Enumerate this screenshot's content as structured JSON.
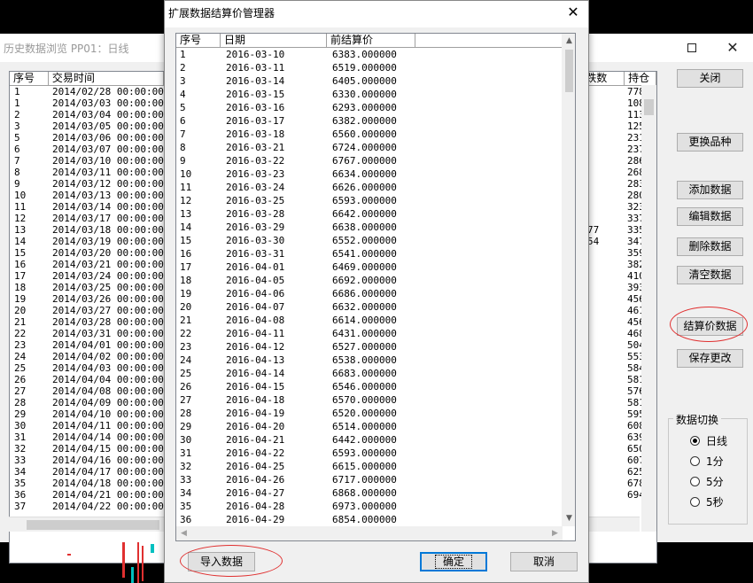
{
  "background_window": {
    "title": "历史数据浏览 PP01：日线",
    "columns": [
      "序号",
      "交易时间"
    ],
    "right_columns": [
      "跌数",
      "持仓"
    ],
    "rows": [
      [
        "1",
        "2014/02/28 00:00:00"
      ],
      [
        "1",
        "2014/03/03 00:00:00"
      ],
      [
        "2",
        "2014/03/04 00:00:00"
      ],
      [
        "3",
        "2014/03/05 00:00:00"
      ],
      [
        "5",
        "2014/03/06 00:00:00"
      ],
      [
        "6",
        "2014/03/07 00:00:00"
      ],
      [
        "7",
        "2014/03/10 00:00:00"
      ],
      [
        "8",
        "2014/03/11 00:00:00"
      ],
      [
        "9",
        "2014/03/12 00:00:00"
      ],
      [
        "10",
        "2014/03/13 00:00:00"
      ],
      [
        "11",
        "2014/03/14 00:00:00"
      ],
      [
        "12",
        "2014/03/17 00:00:00"
      ],
      [
        "13",
        "2014/03/18 00:00:00"
      ],
      [
        "14",
        "2014/03/19 00:00:00"
      ],
      [
        "15",
        "2014/03/20 00:00:00"
      ],
      [
        "16",
        "2014/03/21 00:00:00"
      ],
      [
        "17",
        "2014/03/24 00:00:00"
      ],
      [
        "18",
        "2014/03/25 00:00:00"
      ],
      [
        "19",
        "2014/03/26 00:00:00"
      ],
      [
        "20",
        "2014/03/27 00:00:00"
      ],
      [
        "21",
        "2014/03/28 00:00:00"
      ],
      [
        "22",
        "2014/03/31 00:00:00"
      ],
      [
        "23",
        "2014/04/01 00:00:00"
      ],
      [
        "24",
        "2014/04/02 00:00:00"
      ],
      [
        "25",
        "2014/04/03 00:00:00"
      ],
      [
        "26",
        "2014/04/04 00:00:00"
      ],
      [
        "27",
        "2014/04/08 00:00:00"
      ],
      [
        "28",
        "2014/04/09 00:00:00"
      ],
      [
        "29",
        "2014/04/10 00:00:00"
      ],
      [
        "30",
        "2014/04/11 00:00:00"
      ],
      [
        "31",
        "2014/04/14 00:00:00"
      ],
      [
        "32",
        "2014/04/15 00:00:00"
      ],
      [
        "33",
        "2014/04/16 00:00:00"
      ],
      [
        "34",
        "2014/04/17 00:00:00"
      ],
      [
        "35",
        "2014/04/18 00:00:00"
      ],
      [
        "36",
        "2014/04/21 00:00:00"
      ],
      [
        "37",
        "2014/04/22 00:00:00"
      ]
    ],
    "partial_col_a": [
      "",
      "",
      "",
      "",
      "",
      "",
      "",
      "",
      "",
      "",
      "",
      "",
      "77",
      "54"
    ],
    "partial_col_b": [
      "778",
      "108",
      "113",
      "125",
      "231",
      "237",
      "286",
      "268",
      "283",
      "280",
      "323",
      "337",
      "335",
      "347",
      "359",
      "382",
      "410",
      "393",
      "456",
      "461",
      "456",
      "468",
      "504",
      "553",
      "584",
      "581",
      "576",
      "581",
      "595",
      "608",
      "639",
      "650",
      "607",
      "625",
      "678",
      "694"
    ],
    "side_buttons": {
      "close": "关闭",
      "change_variety": "更换品种",
      "add_data": "添加数据",
      "edit_data": "编辑数据",
      "delete_data": "删除数据",
      "clear_data": "清空数据",
      "settlement_data": "结算价数据",
      "save_changes": "保存更改"
    },
    "data_switch": {
      "title": "数据切换",
      "options": [
        "日线",
        "1分",
        "5分",
        "5秒"
      ],
      "selected": "日线"
    }
  },
  "dialog": {
    "title": "扩展数据结算价管理器",
    "columns": [
      "序号",
      "日期",
      "前结算价"
    ],
    "rows": [
      [
        "1",
        "2016-03-10",
        "6383.000000"
      ],
      [
        "2",
        "2016-03-11",
        "6519.000000"
      ],
      [
        "3",
        "2016-03-14",
        "6405.000000"
      ],
      [
        "4",
        "2016-03-15",
        "6330.000000"
      ],
      [
        "5",
        "2016-03-16",
        "6293.000000"
      ],
      [
        "6",
        "2016-03-17",
        "6382.000000"
      ],
      [
        "7",
        "2016-03-18",
        "6560.000000"
      ],
      [
        "8",
        "2016-03-21",
        "6724.000000"
      ],
      [
        "9",
        "2016-03-22",
        "6767.000000"
      ],
      [
        "10",
        "2016-03-23",
        "6634.000000"
      ],
      [
        "11",
        "2016-03-24",
        "6626.000000"
      ],
      [
        "12",
        "2016-03-25",
        "6593.000000"
      ],
      [
        "13",
        "2016-03-28",
        "6642.000000"
      ],
      [
        "14",
        "2016-03-29",
        "6638.000000"
      ],
      [
        "15",
        "2016-03-30",
        "6552.000000"
      ],
      [
        "16",
        "2016-03-31",
        "6541.000000"
      ],
      [
        "17",
        "2016-04-01",
        "6469.000000"
      ],
      [
        "18",
        "2016-04-05",
        "6692.000000"
      ],
      [
        "19",
        "2016-04-06",
        "6686.000000"
      ],
      [
        "20",
        "2016-04-07",
        "6632.000000"
      ],
      [
        "21",
        "2016-04-08",
        "6614.000000"
      ],
      [
        "22",
        "2016-04-11",
        "6431.000000"
      ],
      [
        "23",
        "2016-04-12",
        "6527.000000"
      ],
      [
        "24",
        "2016-04-13",
        "6538.000000"
      ],
      [
        "25",
        "2016-04-14",
        "6683.000000"
      ],
      [
        "26",
        "2016-04-15",
        "6546.000000"
      ],
      [
        "27",
        "2016-04-18",
        "6570.000000"
      ],
      [
        "28",
        "2016-04-19",
        "6520.000000"
      ],
      [
        "29",
        "2016-04-20",
        "6514.000000"
      ],
      [
        "30",
        "2016-04-21",
        "6442.000000"
      ],
      [
        "31",
        "2016-04-22",
        "6593.000000"
      ],
      [
        "32",
        "2016-04-25",
        "6615.000000"
      ],
      [
        "33",
        "2016-04-26",
        "6717.000000"
      ],
      [
        "34",
        "2016-04-27",
        "6868.000000"
      ],
      [
        "35",
        "2016-04-28",
        "6973.000000"
      ],
      [
        "36",
        "2016-04-29",
        "6854.000000"
      ]
    ],
    "buttons": {
      "import": "导入数据",
      "ok": "确定",
      "cancel": "取消"
    }
  },
  "colors": {
    "annotation": "#e03030",
    "focus": "#0078d7"
  }
}
